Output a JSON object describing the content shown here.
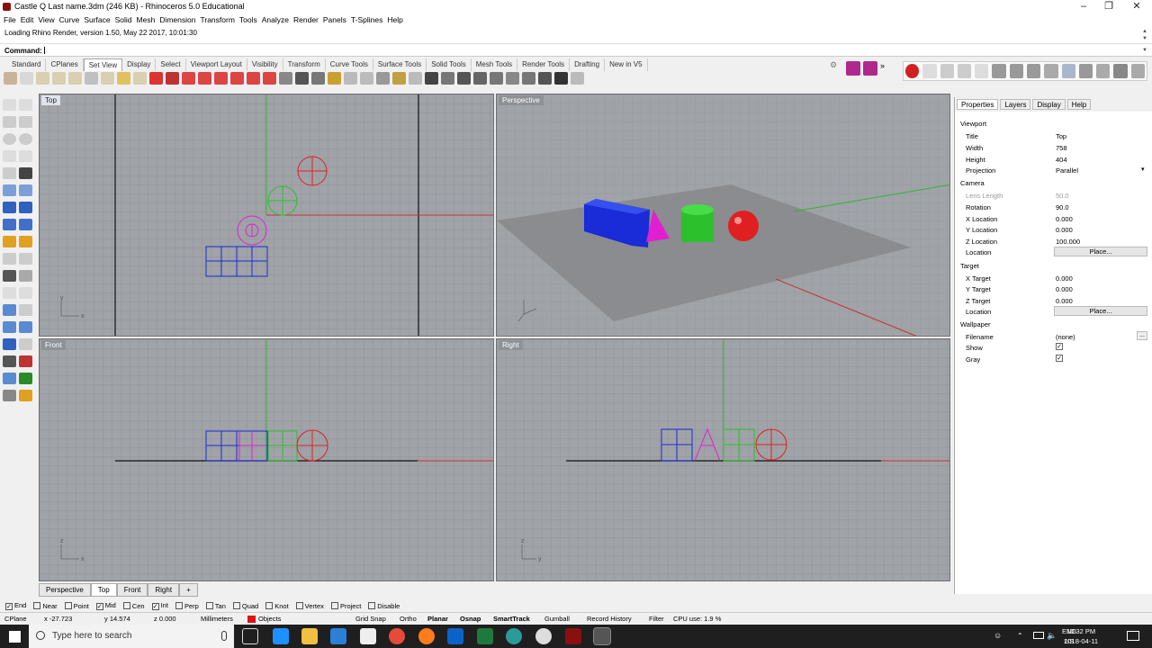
{
  "window": {
    "title": "Castle Q Last name.3dm (246 KB) - Rhinoceros 5.0 Educational"
  },
  "menu": [
    "File",
    "Edit",
    "View",
    "Curve",
    "Surface",
    "Solid",
    "Mesh",
    "Dimension",
    "Transform",
    "Tools",
    "Analyze",
    "Render",
    "Panels",
    "T-Splines",
    "Help"
  ],
  "history": "Loading Rhino Render, version 1.50, May 22 2017, 10:01:30",
  "command_label": "Command:",
  "toolbar_tabs": [
    "Standard",
    "CPlanes",
    "Set View",
    "Display",
    "Select",
    "Viewport Layout",
    "Visibility",
    "Transform",
    "Curve Tools",
    "Surface Tools",
    "Solid Tools",
    "Mesh Tools",
    "Render Tools",
    "Drafting",
    "New in V5"
  ],
  "viewports": {
    "top": "Top",
    "perspective": "Perspective",
    "front": "Front",
    "right": "Right"
  },
  "viewport_tabs": [
    "Perspective",
    "Top",
    "Front",
    "Right"
  ],
  "panel": {
    "tabs": [
      "Properties",
      "Layers",
      "Display",
      "Help"
    ],
    "viewport_section": "Viewport",
    "title_label": "Title",
    "title_value": "Top",
    "width_label": "Width",
    "width_value": "758",
    "height_label": "Height",
    "height_value": "404",
    "projection_label": "Projection",
    "projection_value": "Parallel",
    "camera_section": "Camera",
    "lens_label": "Lens Length",
    "lens_value": "50.0",
    "rotation_label": "Rotation",
    "rotation_value": "90.0",
    "xloc_label": "X Location",
    "xloc_value": "0.000",
    "yloc_label": "Y Location",
    "yloc_value": "0.000",
    "zloc_label": "Z Location",
    "zloc_value": "100.000",
    "location_label": "Location",
    "place_button": "Place...",
    "target_section": "Target",
    "xt_label": "X Target",
    "xt_value": "0.000",
    "yt_label": "Y Target",
    "yt_value": "0.000",
    "zt_label": "Z Target",
    "zt_value": "0.000",
    "tlocation_label": "Location",
    "tplace_button": "Place...",
    "wallpaper_section": "Wallpaper",
    "filename_label": "Filename",
    "filename_value": "(none)",
    "browse": "...",
    "show_label": "Show",
    "gray_label": "Gray"
  },
  "osnap": [
    {
      "label": "End",
      "checked": true
    },
    {
      "label": "Near",
      "checked": false
    },
    {
      "label": "Point",
      "checked": false
    },
    {
      "label": "Mid",
      "checked": true
    },
    {
      "label": "Cen",
      "checked": false
    },
    {
      "label": "Int",
      "checked": true
    },
    {
      "label": "Perp",
      "checked": false
    },
    {
      "label": "Tan",
      "checked": false
    },
    {
      "label": "Quad",
      "checked": false
    },
    {
      "label": "Knot",
      "checked": false
    },
    {
      "label": "Vertex",
      "checked": false
    },
    {
      "label": "Project",
      "checked": false
    },
    {
      "label": "Disable",
      "checked": false
    }
  ],
  "status": {
    "cplane": "CPlane",
    "x": "x -27.723",
    "y": "y 14.574",
    "z": "z 0.000",
    "units": "Millimeters",
    "layer": "Objects",
    "layer_color": "#e01010",
    "grid_snap": "Grid Snap",
    "ortho": "Ortho",
    "planar": "Planar",
    "osnap": "Osnap",
    "smarttrack": "SmartTrack",
    "gumball": "Gumball",
    "record": "Record History",
    "filter": "Filter",
    "cpu": "CPU use: 1.9 %"
  },
  "taskbar": {
    "search_placeholder": "Type here to search",
    "lang1": "ENG",
    "lang2": "US",
    "time": "10:32 PM",
    "date": "2018-04-11"
  },
  "colors": {
    "accent": "#0078d7",
    "x_axis": "#c83232",
    "y_axis": "#32b432",
    "box_blue": "#1a2bd8",
    "magenta": "#e020d0",
    "green": "#2cc02c",
    "red": "#e02020"
  }
}
